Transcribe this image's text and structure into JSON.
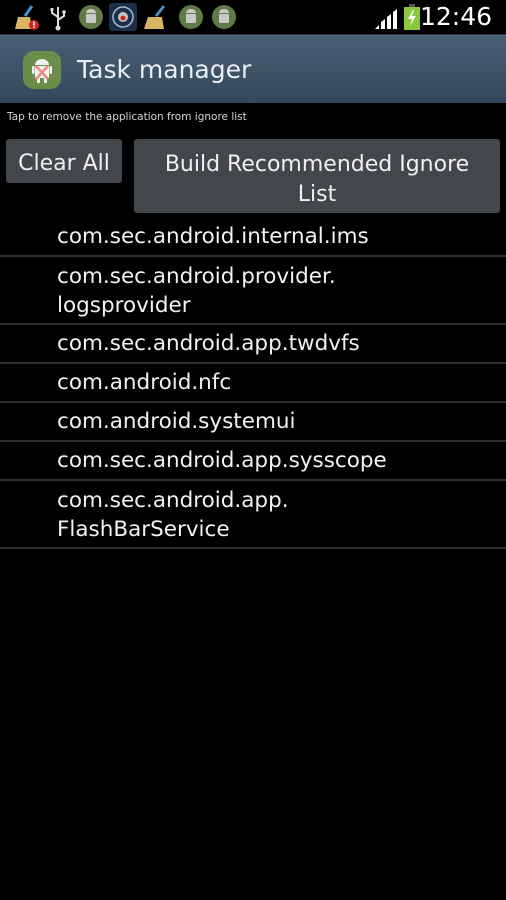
{
  "status_bar": {
    "notification_icons": [
      "broom-alert-icon",
      "usb-icon",
      "android-app-icon",
      "security-app-icon",
      "broom-icon",
      "android-app-icon",
      "android-app-icon"
    ],
    "signal_icon": "signal-strength-icon",
    "battery_icon": "battery-charging-icon",
    "time": "12:46",
    "colors": {
      "battery": "#8cc63f"
    }
  },
  "action_bar": {
    "title": "Task manager",
    "icon": "task-manager-app-icon",
    "colors": {
      "background": "#3e5366",
      "icon_bg": "#6b8d4a"
    }
  },
  "hint_text": "Tap to remove the application from ignore list",
  "buttons": {
    "clear_all": "Clear All",
    "build_recommended": "Build Recommended Ignore List"
  },
  "ignore_list": [
    "com.sec.android.internal.ims",
    "com.sec.android.provider.\nlogsprovider",
    "com.sec.android.app.twdvfs",
    "com.android.nfc",
    "com.android.systemui",
    "com.sec.android.app.sysscope",
    "com.sec.android.app.\nFlashBarService"
  ]
}
